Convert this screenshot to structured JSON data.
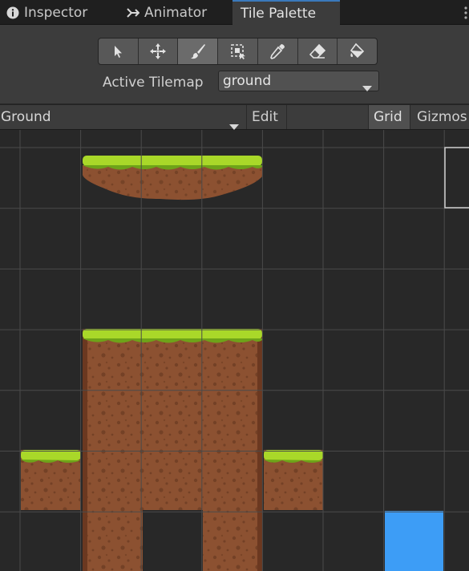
{
  "tabs": [
    {
      "label": "Inspector",
      "icon": "info-icon",
      "active": false
    },
    {
      "label": "Animator",
      "icon": "animator-icon",
      "active": false
    },
    {
      "label": "Tile Palette",
      "icon": "",
      "active": true
    }
  ],
  "tools": [
    {
      "name": "select-tool",
      "icon": "cursor-arrow-icon",
      "active": false
    },
    {
      "name": "move-tool",
      "icon": "move-arrows-icon",
      "active": false
    },
    {
      "name": "paint-tool",
      "icon": "paintbrush-icon",
      "active": true
    },
    {
      "name": "box-fill-tool",
      "icon": "box-select-icon",
      "active": false
    },
    {
      "name": "picker-tool",
      "icon": "eyedropper-icon",
      "active": false
    },
    {
      "name": "erase-tool",
      "icon": "eraser-icon",
      "active": false
    },
    {
      "name": "fill-tool",
      "icon": "paint-bucket-icon",
      "active": false
    }
  ],
  "active_tilemap": {
    "label": "Active Tilemap",
    "value": "ground"
  },
  "palette_bar": {
    "palette_name": "Ground",
    "edit_label": "Edit",
    "grid_label": "Grid",
    "gizmos_label": "Gizmos"
  },
  "colors": {
    "grass": "#a9d829",
    "grass_dark": "#6ea319",
    "dirt": "#8c5131",
    "dirt_dark": "#6b3820",
    "dirt_spot": "#744126",
    "selection": "#3d9df6",
    "grid_line": "#4a4a4a",
    "tab_accent": "#3a79bb"
  }
}
